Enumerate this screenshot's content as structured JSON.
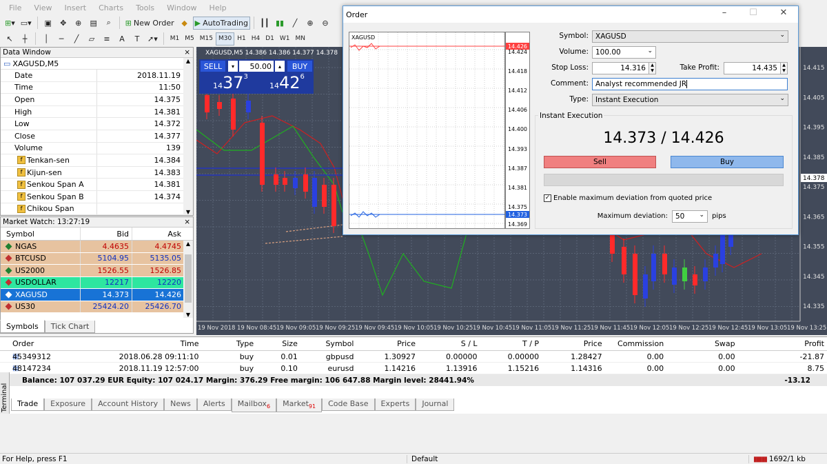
{
  "menu": [
    "File",
    "View",
    "Insert",
    "Charts",
    "Tools",
    "Window",
    "Help"
  ],
  "toolbar": {
    "new_order": "New Order",
    "autotrading": "AutoTrading",
    "timeframes": [
      "M1",
      "M5",
      "M15",
      "M30",
      "H1",
      "H4",
      "D1",
      "W1",
      "MN"
    ],
    "active_tf": "M30"
  },
  "data_window": {
    "title": "Data Window",
    "symbol": "XAGUSD,M5",
    "rows": [
      {
        "k": "Date",
        "v": "2018.11.19"
      },
      {
        "k": "Time",
        "v": "11:50"
      },
      {
        "k": "Open",
        "v": "14.375"
      },
      {
        "k": "High",
        "v": "14.381"
      },
      {
        "k": "Low",
        "v": "14.372"
      },
      {
        "k": "Close",
        "v": "14.377"
      },
      {
        "k": "Volume",
        "v": "139"
      },
      {
        "k": "Tenkan-sen",
        "v": "14.384"
      },
      {
        "k": "Kijun-sen",
        "v": "14.383"
      },
      {
        "k": "Senkou Span A",
        "v": "14.381"
      },
      {
        "k": "Senkou Span B",
        "v": "14.374"
      },
      {
        "k": "Chikou Span",
        "v": ""
      }
    ]
  },
  "market_watch": {
    "title": "Market Watch: 13:27:19",
    "headers": {
      "symbol": "Symbol",
      "bid": "Bid",
      "ask": "Ask"
    },
    "rows": [
      {
        "s": "NGAS",
        "b": "4.4635",
        "a": "4.4745",
        "bg": "#e7c3a0",
        "fg": "#c00000"
      },
      {
        "s": "BTCUSD",
        "b": "5104.95",
        "a": "5135.05",
        "bg": "#e7c3a0",
        "fg": "#1030c0"
      },
      {
        "s": "US2000",
        "b": "1526.55",
        "a": "1526.85",
        "bg": "#e7c3a0",
        "fg": "#c00000"
      },
      {
        "s": "USDOLLAR",
        "b": "12217",
        "a": "12220",
        "bg": "#2ee6a0",
        "fg": "#1030c0"
      },
      {
        "s": "XAGUSD",
        "b": "14.373",
        "a": "14.426",
        "bg": "#1873d6",
        "fg": "#ffffff"
      },
      {
        "s": "US30",
        "b": "25424.20",
        "a": "25426.70",
        "bg": "#e7c3a0",
        "fg": "#1030c0"
      }
    ],
    "tabs": [
      "Symbols",
      "Tick Chart"
    ]
  },
  "chart": {
    "label": "XAGUSD,M5   14.386 14.386 14.377 14.378",
    "oneclick": {
      "sell": "SELL",
      "buy": "BUY",
      "lots": "50.00",
      "sell_big": "37",
      "sell_small": "14",
      "sell_sup": "3",
      "buy_big": "42",
      "buy_small": "14",
      "buy_sup": "6"
    },
    "y_ticks": [
      "14.415",
      "14.405",
      "14.395",
      "14.385",
      "14.378",
      "14.375",
      "14.365",
      "14.355",
      "14.345",
      "14.335"
    ],
    "current": "14.378",
    "x_ticks": [
      "19 Nov 2018",
      "19 Nov 08:45",
      "19 Nov 09:05",
      "19 Nov 09:25",
      "19 Nov 09:45",
      "19 Nov 10:05",
      "19 Nov 10:25",
      "19 Nov 10:45",
      "19 Nov 11:05",
      "19 Nov 11:25",
      "19 Nov 11:45",
      "19 Nov 12:05",
      "19 Nov 12:25",
      "19 Nov 12:45",
      "19 Nov 13:05",
      "19 Nov 13:25"
    ]
  },
  "order": {
    "title": "Order",
    "mini_symbol": "XAGUSD",
    "mini_ticks": [
      "14.426",
      "14.424",
      "14.418",
      "14.412",
      "14.406",
      "14.400",
      "14.393",
      "14.387",
      "14.381",
      "14.375",
      "14.373",
      "14.369"
    ],
    "symbol_label": "Symbol:",
    "symbol": "XAGUSD",
    "volume_label": "Volume:",
    "volume": "100.00",
    "sl_label": "Stop Loss:",
    "sl": "14.316",
    "tp_label": "Take Profit:",
    "tp": "14.435",
    "comment_label": "Comment:",
    "comment": "Analyst recommended JR",
    "type_label": "Type:",
    "type": "Instant Execution",
    "group": "Instant Execution",
    "quote": "14.373 / 14.426",
    "sell": "Sell",
    "buy": "Buy",
    "deviation_check": "Enable maximum deviation from quoted price",
    "maxdev_label": "Maximum deviation:",
    "maxdev": "50",
    "pips": "pips"
  },
  "terminal": {
    "headers": {
      "order": "Order",
      "time": "Time",
      "type": "Type",
      "size": "Size",
      "symbol": "Symbol",
      "price": "Price",
      "sl": "S / L",
      "tp": "T / P",
      "price2": "Price",
      "commission": "Commission",
      "swap": "Swap",
      "profit": "Profit"
    },
    "rows": [
      {
        "order": "45349312",
        "time": "2018.06.28 09:11:10",
        "type": "buy",
        "size": "0.01",
        "symbol": "gbpusd",
        "price": "1.30927",
        "sl": "0.00000",
        "tp": "0.00000",
        "price2": "1.28427",
        "commission": "0.00",
        "swap": "0.00",
        "profit": "-21.87"
      },
      {
        "order": "48147234",
        "time": "2018.11.19 12:57:00",
        "type": "buy",
        "size": "0.10",
        "symbol": "eurusd",
        "price": "1.14216",
        "sl": "1.13916",
        "tp": "1.15216",
        "price2": "1.14316",
        "commission": "0.00",
        "swap": "0.00",
        "profit": "8.75"
      }
    ],
    "balance": "Balance: 107 037.29 EUR  Equity: 107 024.17  Margin: 376.29  Free margin: 106 647.88  Margin level: 28441.94%",
    "total": "-13.12",
    "side": "Terminal",
    "tabs": [
      {
        "l": "Trade",
        "b": ""
      },
      {
        "l": "Exposure",
        "b": ""
      },
      {
        "l": "Account History",
        "b": ""
      },
      {
        "l": "News",
        "b": ""
      },
      {
        "l": "Alerts",
        "b": ""
      },
      {
        "l": "Mailbox",
        "b": "6"
      },
      {
        "l": "Market",
        "b": "91"
      },
      {
        "l": "Code Base",
        "b": ""
      },
      {
        "l": "Experts",
        "b": ""
      },
      {
        "l": "Journal",
        "b": ""
      }
    ]
  },
  "status": {
    "help": "For Help, press F1",
    "profile": "Default",
    "traffic": "1692/1 kb"
  }
}
